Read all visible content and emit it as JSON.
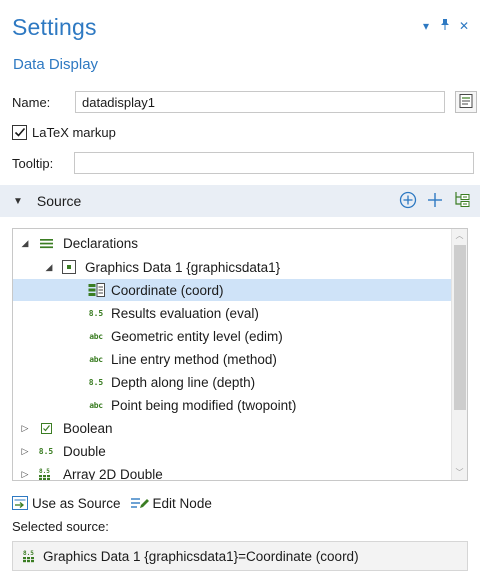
{
  "header": {
    "title": "Settings",
    "subtitle": "Data Display",
    "controls": [
      {
        "icon": "dropdown-arrow-icon",
        "glyph": "▾"
      },
      {
        "icon": "pin-icon",
        "glyph": "⚲"
      },
      {
        "icon": "close-icon",
        "glyph": "✕"
      }
    ]
  },
  "form": {
    "name_label": "Name:",
    "name_value": "datadisplay1",
    "latex_label": "LaTeX markup",
    "latex_checked": true,
    "tooltip_label": "Tooltip:",
    "tooltip_value": ""
  },
  "source_section": {
    "label": "Source",
    "expanded": true
  },
  "tree": {
    "items": [
      {
        "label": "Declarations",
        "icon": "declarations-icon",
        "expanded": true
      },
      {
        "label": "Graphics Data 1 {graphicsdata1}",
        "icon": "graphics-data-icon",
        "expanded": true
      },
      {
        "label": "Coordinate (coord)",
        "icon": "coordinate-icon",
        "selected": true
      },
      {
        "label": "Results evaluation (eval)",
        "icon": "double-icon",
        "badge": "8.5"
      },
      {
        "label": "Geometric entity level (edim)",
        "icon": "string-icon",
        "badge": "abc"
      },
      {
        "label": "Line entry method (method)",
        "icon": "string-icon",
        "badge": "abc"
      },
      {
        "label": "Depth along line (depth)",
        "icon": "double-icon",
        "badge": "8.5"
      },
      {
        "label": "Point being modified (twopoint)",
        "icon": "string-icon",
        "badge": "abc"
      },
      {
        "label": "Boolean",
        "icon": "boolean-icon",
        "expanded": false
      },
      {
        "label": "Double",
        "icon": "double-icon",
        "badge": "8.5",
        "expanded": false
      },
      {
        "label": "Array 2D Double",
        "icon": "array-2d-double-icon",
        "expanded": false
      }
    ]
  },
  "actions": {
    "use_as_source": "Use as Source",
    "edit_node": "Edit Node"
  },
  "selected_source": {
    "label": "Selected source:",
    "value": "Graphics Data 1 {graphicsdata1}=Coordinate (coord)"
  },
  "colors": {
    "accent": "#2e79c2",
    "section_bg": "#e9eef5",
    "selection_bg": "#cfe3f8",
    "badge_green": "#3b7d23"
  }
}
